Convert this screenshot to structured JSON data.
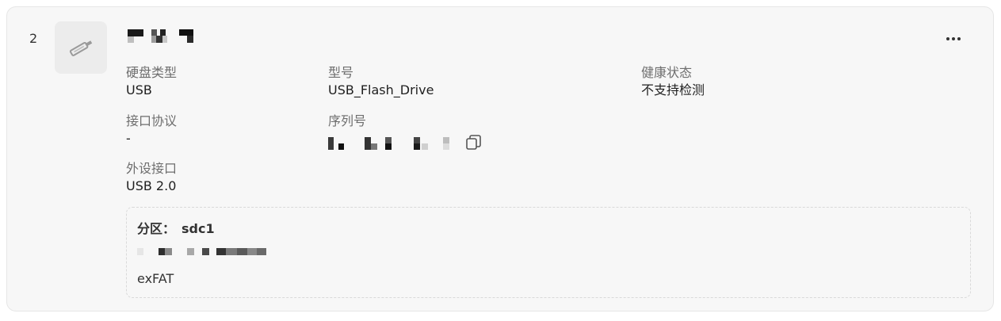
{
  "disk": {
    "index": "2",
    "icon": "usb-drive-icon",
    "fields": {
      "disk_type_label": "硬盘类型",
      "disk_type_value": "USB",
      "model_label": "型号",
      "model_value": "USB_Flash_Drive",
      "health_label": "健康状态",
      "health_value": "不支持检测",
      "interface_label": "接口协议",
      "interface_value": "-",
      "serial_label": "序列号",
      "peripheral_label": "外设接口",
      "peripheral_value": "USB 2.0"
    },
    "more_icon": "more-horizontal-icon",
    "copy_icon": "copy-icon"
  },
  "partition": {
    "label": "分区：",
    "name": "sdc1",
    "filesystem": "exFAT"
  }
}
